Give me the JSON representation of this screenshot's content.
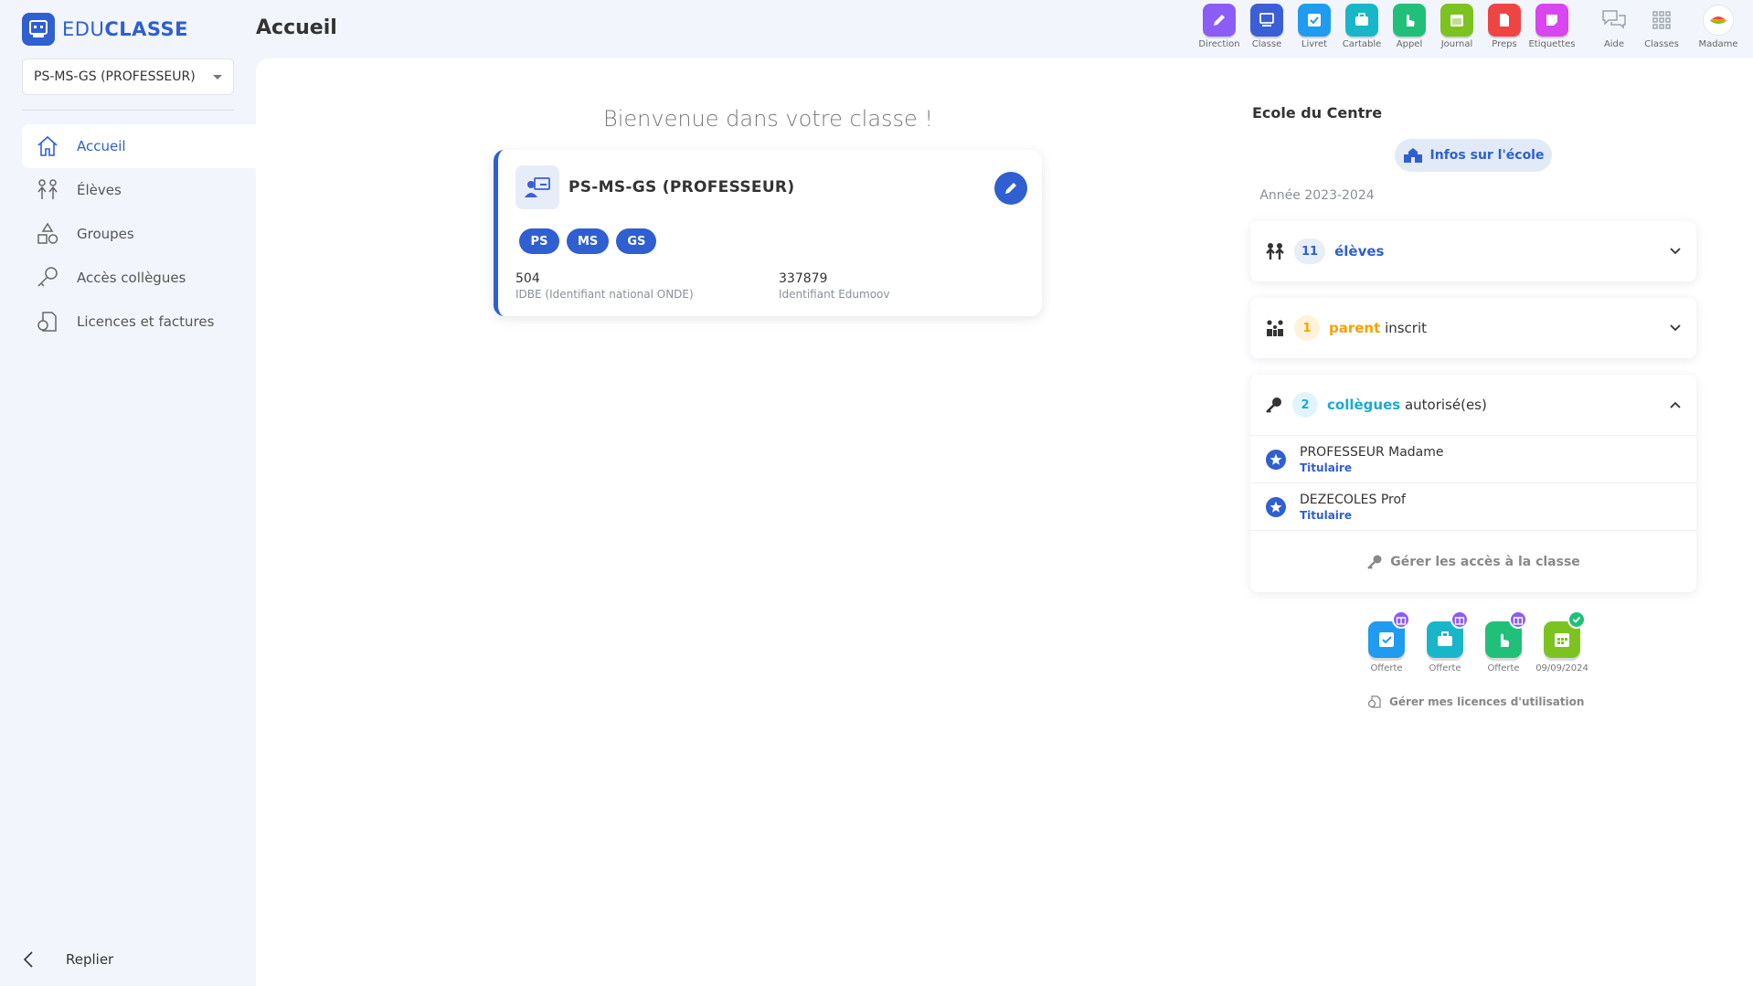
{
  "app": {
    "brand_prefix": "EDU",
    "brand_suffix": "CLASSE"
  },
  "header": {
    "title": "Accueil"
  },
  "sidebar": {
    "class_select": "PS-MS-GS (PROFESSEUR)",
    "items": [
      {
        "label": "Accueil",
        "icon": "home-icon",
        "active": true
      },
      {
        "label": "Élèves",
        "icon": "students-icon"
      },
      {
        "label": "Groupes",
        "icon": "shapes-icon"
      },
      {
        "label": "Accès collègues",
        "icon": "key-icon"
      },
      {
        "label": "Licences et factures",
        "icon": "license-icon"
      }
    ],
    "collapse_label": "Replier"
  },
  "topbar": {
    "apps": [
      {
        "label": "Direction",
        "color": "#8b5cf6"
      },
      {
        "label": "Classe",
        "color": "#3b5fd6"
      },
      {
        "label": "Livret",
        "color": "#1f9bf0"
      },
      {
        "label": "Cartable",
        "color": "#19b6c9"
      },
      {
        "label": "Appel",
        "color": "#21c07a"
      },
      {
        "label": "Journal",
        "color": "#7cc320"
      },
      {
        "label": "Preps",
        "color": "#ef4444"
      },
      {
        "label": "Etiquettes",
        "color": "#d946ef"
      },
      {
        "label": "Aide",
        "color": "#9aa2ad"
      },
      {
        "label": "Classes",
        "color": "#9aa2ad"
      },
      {
        "label": "Madame",
        "color": "#ffffff"
      }
    ]
  },
  "main": {
    "welcome": "Bienvenue dans votre classe !",
    "class_card": {
      "name": "PS-MS-GS (PROFESSEUR)",
      "levels": [
        "PS",
        "MS",
        "GS"
      ],
      "idbe_value": "504",
      "idbe_label": "IDBE (Identifiant national ONDE)",
      "edumoov_value": "337879",
      "edumoov_label": "Identifiant Edumoov"
    }
  },
  "school": {
    "name": "Ecole du Centre",
    "info_button": "Infos sur l'école",
    "year": "Année 2023-2024",
    "students": {
      "count": "11",
      "label": "élèves"
    },
    "parents": {
      "count": "1",
      "label": "parent",
      "suffix": "inscrit"
    },
    "colleagues": {
      "count": "2",
      "label": "collègues",
      "suffix": "autorisé(es)",
      "list": [
        {
          "name": "PROFESSEUR Madame",
          "role": "Titulaire"
        },
        {
          "name": "DEZECOLES Prof",
          "role": "Titulaire"
        }
      ],
      "manage": "Gérer les accès à la classe"
    },
    "licenses": [
      {
        "label": "Offerte",
        "color": "#1f9bf0",
        "badge": "gift"
      },
      {
        "label": "Offerte",
        "color": "#19b6c9",
        "badge": "gift"
      },
      {
        "label": "Offerte",
        "color": "#21c07a",
        "badge": "gift"
      },
      {
        "label": "09/09/2024",
        "color": "#7cc320",
        "badge": "check"
      }
    ],
    "licenses_manage": "Gérer mes licences d'utilisation"
  },
  "colors": {
    "primary": "#2f5fd0",
    "orange": "#f5a300",
    "cyan": "#1aa9d6"
  }
}
